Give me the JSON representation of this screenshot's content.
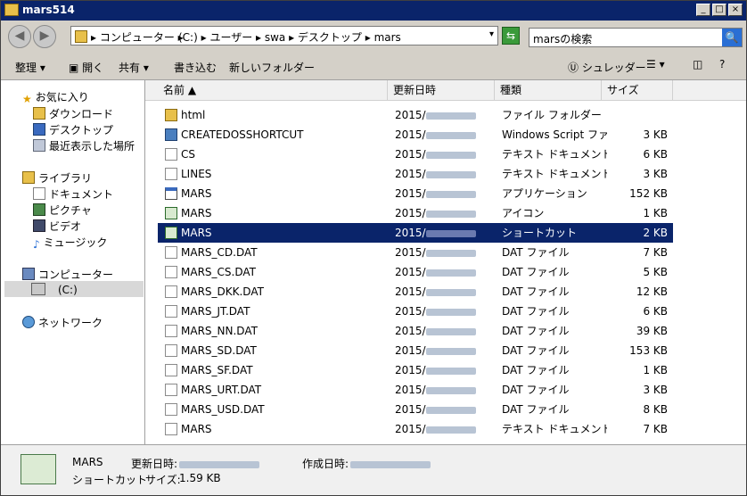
{
  "window": {
    "title": "mars514",
    "min_label": "_",
    "max_label": "□",
    "close_label": "×"
  },
  "address": {
    "back_label": "◀",
    "forward_label": "▶",
    "segments": [
      "▸ コンピューター ▸",
      "(C:) ▸ ユーザー ▸ swa ▸ デスクトップ ▸ mars"
    ],
    "drop_label": "▾",
    "history_label": "▾"
  },
  "search": {
    "placeholder": "marsの検索",
    "button_label": "🔍"
  },
  "toolbar": {
    "organize": "整理 ▾",
    "open": "開く",
    "share": "共有 ▾",
    "burn": "書き込む",
    "new_folder": "新しいフォルダー",
    "shredder": "シュレッダー",
    "view_label": "☰ ▾",
    "help_label": "?"
  },
  "nav": {
    "favorites": "お気に入り",
    "downloads": "ダウンロード",
    "desktop": "デスクトップ",
    "recent": "最近表示した場所",
    "libraries": "ライブラリ",
    "documents": "ドキュメント",
    "pictures": "ピクチャ",
    "videos": "ビデオ",
    "music": "ミュージック",
    "computer": "コンピューター",
    "drive_c": "(C:)",
    "network": "ネットワーク"
  },
  "columns": {
    "name": "名前 ▲",
    "modified": "更新日時",
    "type": "種類",
    "size": "サイズ"
  },
  "files": [
    {
      "name": "html",
      "date": "2015/",
      "type": "ファイル フォルダー",
      "size": "",
      "icon": "folder-icon"
    },
    {
      "name": "CREATEDOSSHORTCUT",
      "date": "2015/",
      "type": "Windows Script ファ...",
      "size": "3 KB",
      "icon": "script-icon"
    },
    {
      "name": "CS",
      "date": "2015/",
      "type": "テキスト ドキュメント",
      "size": "6 KB",
      "icon": "document-icon"
    },
    {
      "name": "LINES",
      "date": "2015/",
      "type": "テキスト ドキュメント",
      "size": "3 KB",
      "icon": "document-icon"
    },
    {
      "name": "MARS",
      "date": "2015/",
      "type": "アプリケーション",
      "size": "152 KB",
      "icon": "application-icon"
    },
    {
      "name": "MARS",
      "date": "2015/",
      "type": "アイコン",
      "size": "1 KB",
      "icon": "mars-icon"
    },
    {
      "name": "MARS",
      "date": "2015/",
      "type": "ショートカット",
      "size": "2 KB",
      "icon": "mars-icon"
    },
    {
      "name": "MARS_CD.DAT",
      "date": "2015/",
      "type": "DAT ファイル",
      "size": "7 KB",
      "icon": "document-icon"
    },
    {
      "name": "MARS_CS.DAT",
      "date": "2015/",
      "type": "DAT ファイル",
      "size": "5 KB",
      "icon": "document-icon"
    },
    {
      "name": "MARS_DKK.DAT",
      "date": "2015/",
      "type": "DAT ファイル",
      "size": "12 KB",
      "icon": "document-icon"
    },
    {
      "name": "MARS_JT.DAT",
      "date": "2015/",
      "type": "DAT ファイル",
      "size": "6 KB",
      "icon": "document-icon"
    },
    {
      "name": "MARS_NN.DAT",
      "date": "2015/",
      "type": "DAT ファイル",
      "size": "39 KB",
      "icon": "document-icon"
    },
    {
      "name": "MARS_SD.DAT",
      "date": "2015/",
      "type": "DAT ファイル",
      "size": "153 KB",
      "icon": "document-icon"
    },
    {
      "name": "MARS_SF.DAT",
      "date": "2015/",
      "type": "DAT ファイル",
      "size": "1 KB",
      "icon": "document-icon"
    },
    {
      "name": "MARS_URT.DAT",
      "date": "2015/",
      "type": "DAT ファイル",
      "size": "3 KB",
      "icon": "document-icon"
    },
    {
      "name": "MARS_USD.DAT",
      "date": "2015/",
      "type": "DAT ファイル",
      "size": "8 KB",
      "icon": "document-icon"
    },
    {
      "name": "MARS",
      "date": "2015/",
      "type": "テキスト ドキュメント",
      "size": "7 KB",
      "icon": "document-icon"
    }
  ],
  "selected_index": 6,
  "status": {
    "name": "MARS",
    "type": "ショートカット",
    "modified_label": "更新日時:",
    "created_label": "作成日時:",
    "size_label": "サイズ:",
    "size_value": "1.59 KB"
  }
}
